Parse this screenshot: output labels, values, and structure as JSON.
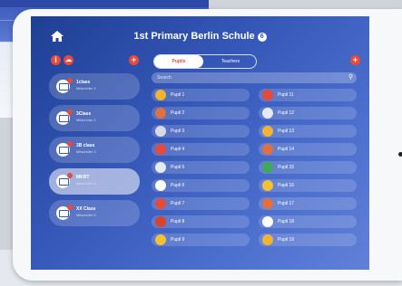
{
  "app": {
    "title": "1st Primary Berlin Schule",
    "title_badge": "6"
  },
  "icons": {
    "home": "home-icon",
    "info": "info-icon",
    "cloud": "cloud-icon",
    "add": "plus-icon",
    "search": "search-icon"
  },
  "colors": {
    "accent": "#e64a3a",
    "screen_bg": "#3557b8"
  },
  "toolbar": {
    "info_label": "i",
    "cloud_label": "☁",
    "add_class_label": "+",
    "add_student_label": "+"
  },
  "tabs": [
    {
      "label": "Pupils"
    },
    {
      "label": "Teachers"
    }
  ],
  "search": {
    "placeholder": "Search"
  },
  "classes": [
    {
      "name": "1class",
      "subtitle": "Mitschüler 1"
    },
    {
      "name": "3Class",
      "subtitle": "Mitschüler 2"
    },
    {
      "name": "3B class",
      "subtitle": "Mitschüler 3"
    },
    {
      "name": "MKRT",
      "subtitle": "Mitschüler 4"
    },
    {
      "name": "XX Class",
      "subtitle": "Mitschüler 5"
    }
  ],
  "students_left": [
    {
      "name": "Pupil 1"
    },
    {
      "name": "Pupil 2"
    },
    {
      "name": "Pupil 3"
    },
    {
      "name": "Pupil 4"
    },
    {
      "name": "Pupil 5"
    },
    {
      "name": "Pupil 6"
    },
    {
      "name": "Pupil 7"
    },
    {
      "name": "Pupil 8"
    },
    {
      "name": "Pupil 9"
    }
  ],
  "students_right": [
    {
      "name": "Pupil 11"
    },
    {
      "name": "Pupil 12"
    },
    {
      "name": "Pupil 13"
    },
    {
      "name": "Pupil 14"
    },
    {
      "name": "Pupil 15"
    },
    {
      "name": "Pupil 16"
    },
    {
      "name": "Pupil 17"
    },
    {
      "name": "Pupil 18"
    },
    {
      "name": "Pupil 19"
    }
  ]
}
